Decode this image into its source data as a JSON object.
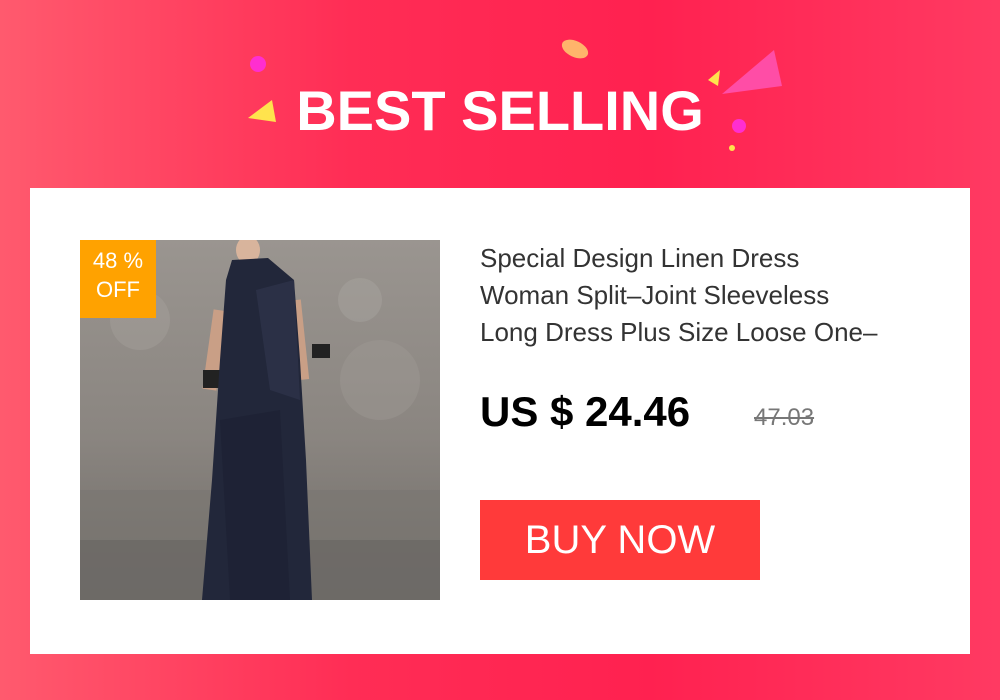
{
  "banner": {
    "title": "BEST SELLING"
  },
  "product": {
    "discount_percent": "48 %",
    "discount_label": "OFF",
    "title_line_1": "Special Design Linen Dress",
    "title_line_2": "Woman Split–Joint Sleeveless",
    "title_line_3": "Long Dress Plus Size Loose One–",
    "price": "US $ 24.46",
    "original_price": "47.03"
  },
  "actions": {
    "buy_label": "BUY NOW"
  },
  "colors": {
    "background": "#ff2d55",
    "badge": "#ffa200",
    "buy_button": "#ff3a3a"
  }
}
